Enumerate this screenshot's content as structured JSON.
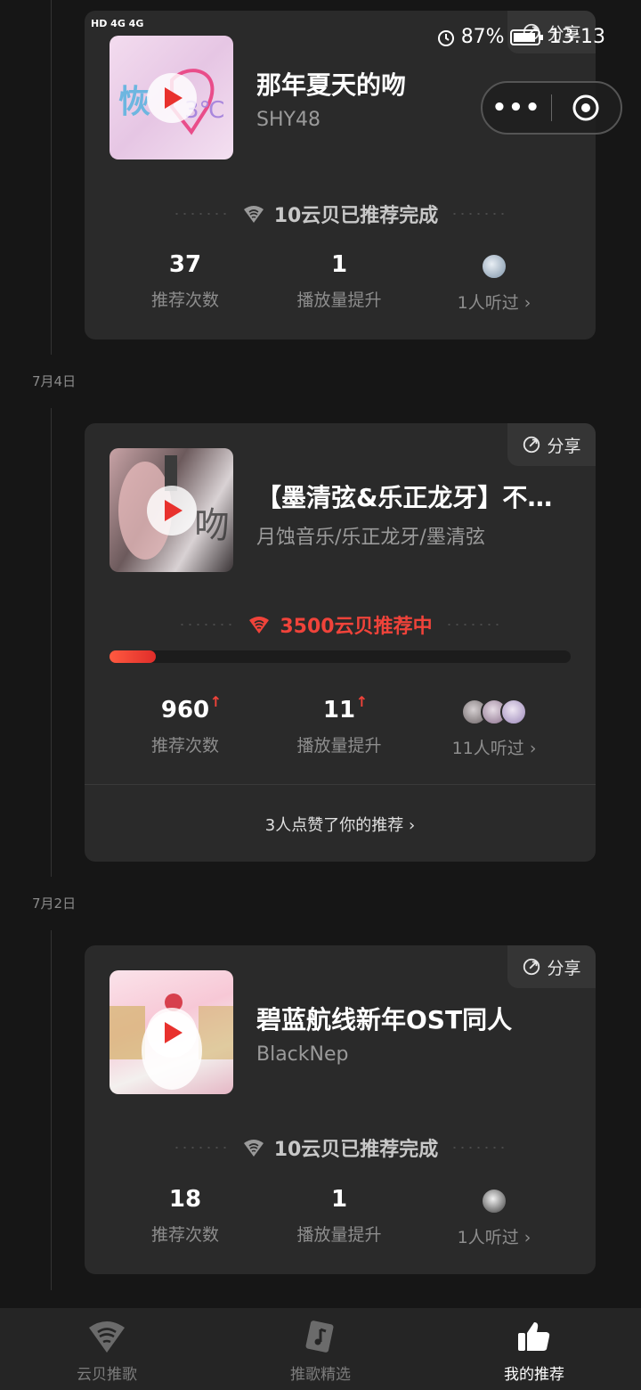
{
  "status_bar": {
    "left_text": "HD 4G 4G",
    "battery": "87%",
    "time": "13:13"
  },
  "capsule": {
    "more_label": "•••"
  },
  "dates": [
    "7月4日",
    "7月2日"
  ],
  "share_label": "分享",
  "cards": [
    {
      "title": "那年夏天的吻",
      "artist": "SHY48",
      "status": "10云贝已推荐完成",
      "status_type": "done",
      "stats": {
        "recommend_count": "37",
        "recommend_label": "推荐次数",
        "play_boost": "1",
        "play_label": "播放量提升",
        "listened": "1人听过"
      }
    },
    {
      "title": "【墨清弦&乐正龙牙】不…",
      "artist": "月蚀音乐/乐正龙牙/墨清弦",
      "status": "3500云贝推荐中",
      "status_type": "active",
      "progress": 0.1,
      "stats": {
        "recommend_count": "960",
        "recommend_label": "推荐次数",
        "play_boost": "11",
        "play_label": "播放量提升",
        "listened": "11人听过"
      },
      "likes": "3人点赞了你的推荐"
    },
    {
      "title": "碧蓝航线新年OST同人",
      "artist": "BlackNep",
      "status": "10云贝已推荐完成",
      "status_type": "done",
      "stats": {
        "recommend_count": "18",
        "recommend_label": "推荐次数",
        "play_boost": "1",
        "play_label": "播放量提升",
        "listened": "1人听过"
      }
    }
  ],
  "tabs": [
    {
      "label": "云贝推歌",
      "icon": "cloud-shell-icon",
      "active": false
    },
    {
      "label": "推歌精选",
      "icon": "music-card-icon",
      "active": false
    },
    {
      "label": "我的推荐",
      "icon": "thumbs-up-icon",
      "active": true
    }
  ],
  "colors": {
    "accent": "#f0433a",
    "card": "#2a2a2a",
    "background": "#161616"
  }
}
